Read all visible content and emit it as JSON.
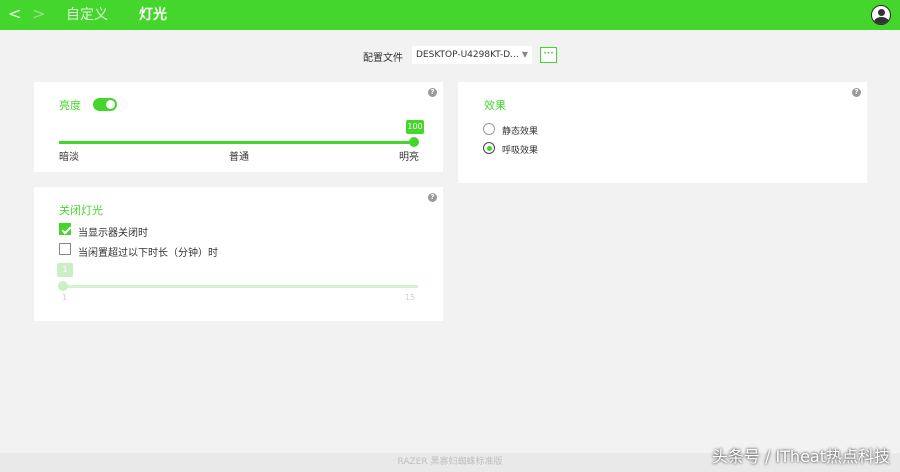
{
  "top_bar": {
    "back_arrow": "<",
    "forward_arrow": ">",
    "nav_customize": "自定义",
    "nav_lighting": "灯光",
    "accent_color": "#44d62c"
  },
  "profile": {
    "label": "配置文件",
    "selected": "DESKTOP-U4298KT-D...",
    "more_label": "···"
  },
  "brightness_card": {
    "title": "亮度",
    "toggle_on": true,
    "slider_value": 100,
    "slider_value_label": "100",
    "slider_percent": 100,
    "labels": {
      "low": "暗淡",
      "mid": "普通",
      "high": "明亮"
    },
    "help": "?"
  },
  "effects_card": {
    "title": "效果",
    "help": "?",
    "options": [
      {
        "label": "静态效果",
        "selected": false
      },
      {
        "label": "呼吸效果",
        "selected": true
      }
    ]
  },
  "lights_off_card": {
    "title": "关闭灯光",
    "help": "?",
    "checkboxes": [
      {
        "label": "当显示器关闭时",
        "checked": true
      },
      {
        "label": "当闲置超过以下时长（分钟）时",
        "checked": false
      }
    ],
    "idle_slider": {
      "value_label": "1",
      "min_label": "1",
      "max_label": "15",
      "percent": 0
    }
  },
  "footer": {
    "product": "RAZER 黑寡妇蜘蛛标准版"
  },
  "watermark": {
    "text": "头条号 / ITheat热点科技"
  }
}
